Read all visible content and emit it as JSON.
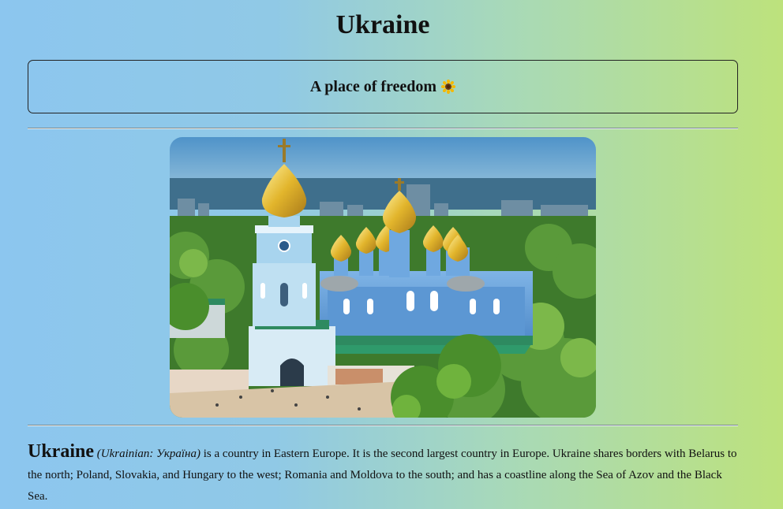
{
  "header": {
    "title": "Ukraine"
  },
  "banner": {
    "text": "A place of freedom",
    "icon": "sunflower-icon"
  },
  "hero_image": {
    "subject": "st-michaels-monastery-kyiv"
  },
  "article": {
    "lead": "Ukraine",
    "native_name": "(Ukrainian: Україна)",
    "body": " is a country in Eastern Europe. It is the second largest country in Europe. Ukraine shares borders with Belarus to the north; Poland, Slovakia, and Hungary to the west; Romania and Moldova to the south; and has a coastline along the Sea of Azov and the Black Sea."
  },
  "colors": {
    "gradient_left": "#8cc6ef",
    "gradient_right": "#bde27c",
    "text": "#111111"
  }
}
